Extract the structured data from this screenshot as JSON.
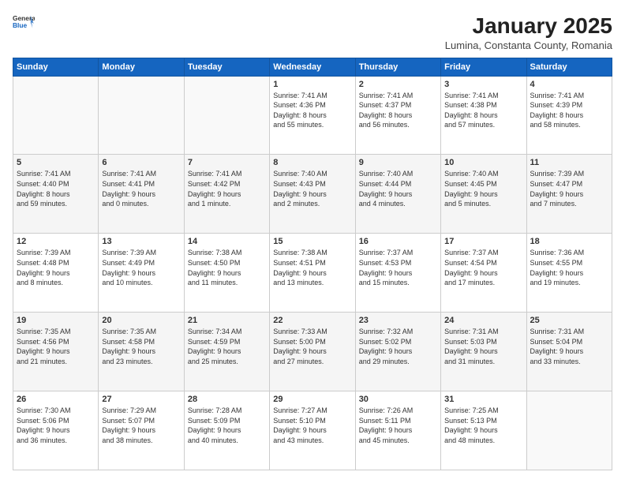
{
  "logo": {
    "general": "General",
    "blue": "Blue"
  },
  "header": {
    "title": "January 2025",
    "subtitle": "Lumina, Constanta County, Romania"
  },
  "weekdays": [
    "Sunday",
    "Monday",
    "Tuesday",
    "Wednesday",
    "Thursday",
    "Friday",
    "Saturday"
  ],
  "weeks": [
    [
      {
        "day": "",
        "info": ""
      },
      {
        "day": "",
        "info": ""
      },
      {
        "day": "",
        "info": ""
      },
      {
        "day": "1",
        "info": "Sunrise: 7:41 AM\nSunset: 4:36 PM\nDaylight: 8 hours\nand 55 minutes."
      },
      {
        "day": "2",
        "info": "Sunrise: 7:41 AM\nSunset: 4:37 PM\nDaylight: 8 hours\nand 56 minutes."
      },
      {
        "day": "3",
        "info": "Sunrise: 7:41 AM\nSunset: 4:38 PM\nDaylight: 8 hours\nand 57 minutes."
      },
      {
        "day": "4",
        "info": "Sunrise: 7:41 AM\nSunset: 4:39 PM\nDaylight: 8 hours\nand 58 minutes."
      }
    ],
    [
      {
        "day": "5",
        "info": "Sunrise: 7:41 AM\nSunset: 4:40 PM\nDaylight: 8 hours\nand 59 minutes."
      },
      {
        "day": "6",
        "info": "Sunrise: 7:41 AM\nSunset: 4:41 PM\nDaylight: 9 hours\nand 0 minutes."
      },
      {
        "day": "7",
        "info": "Sunrise: 7:41 AM\nSunset: 4:42 PM\nDaylight: 9 hours\nand 1 minute."
      },
      {
        "day": "8",
        "info": "Sunrise: 7:40 AM\nSunset: 4:43 PM\nDaylight: 9 hours\nand 2 minutes."
      },
      {
        "day": "9",
        "info": "Sunrise: 7:40 AM\nSunset: 4:44 PM\nDaylight: 9 hours\nand 4 minutes."
      },
      {
        "day": "10",
        "info": "Sunrise: 7:40 AM\nSunset: 4:45 PM\nDaylight: 9 hours\nand 5 minutes."
      },
      {
        "day": "11",
        "info": "Sunrise: 7:39 AM\nSunset: 4:47 PM\nDaylight: 9 hours\nand 7 minutes."
      }
    ],
    [
      {
        "day": "12",
        "info": "Sunrise: 7:39 AM\nSunset: 4:48 PM\nDaylight: 9 hours\nand 8 minutes."
      },
      {
        "day": "13",
        "info": "Sunrise: 7:39 AM\nSunset: 4:49 PM\nDaylight: 9 hours\nand 10 minutes."
      },
      {
        "day": "14",
        "info": "Sunrise: 7:38 AM\nSunset: 4:50 PM\nDaylight: 9 hours\nand 11 minutes."
      },
      {
        "day": "15",
        "info": "Sunrise: 7:38 AM\nSunset: 4:51 PM\nDaylight: 9 hours\nand 13 minutes."
      },
      {
        "day": "16",
        "info": "Sunrise: 7:37 AM\nSunset: 4:53 PM\nDaylight: 9 hours\nand 15 minutes."
      },
      {
        "day": "17",
        "info": "Sunrise: 7:37 AM\nSunset: 4:54 PM\nDaylight: 9 hours\nand 17 minutes."
      },
      {
        "day": "18",
        "info": "Sunrise: 7:36 AM\nSunset: 4:55 PM\nDaylight: 9 hours\nand 19 minutes."
      }
    ],
    [
      {
        "day": "19",
        "info": "Sunrise: 7:35 AM\nSunset: 4:56 PM\nDaylight: 9 hours\nand 21 minutes."
      },
      {
        "day": "20",
        "info": "Sunrise: 7:35 AM\nSunset: 4:58 PM\nDaylight: 9 hours\nand 23 minutes."
      },
      {
        "day": "21",
        "info": "Sunrise: 7:34 AM\nSunset: 4:59 PM\nDaylight: 9 hours\nand 25 minutes."
      },
      {
        "day": "22",
        "info": "Sunrise: 7:33 AM\nSunset: 5:00 PM\nDaylight: 9 hours\nand 27 minutes."
      },
      {
        "day": "23",
        "info": "Sunrise: 7:32 AM\nSunset: 5:02 PM\nDaylight: 9 hours\nand 29 minutes."
      },
      {
        "day": "24",
        "info": "Sunrise: 7:31 AM\nSunset: 5:03 PM\nDaylight: 9 hours\nand 31 minutes."
      },
      {
        "day": "25",
        "info": "Sunrise: 7:31 AM\nSunset: 5:04 PM\nDaylight: 9 hours\nand 33 minutes."
      }
    ],
    [
      {
        "day": "26",
        "info": "Sunrise: 7:30 AM\nSunset: 5:06 PM\nDaylight: 9 hours\nand 36 minutes."
      },
      {
        "day": "27",
        "info": "Sunrise: 7:29 AM\nSunset: 5:07 PM\nDaylight: 9 hours\nand 38 minutes."
      },
      {
        "day": "28",
        "info": "Sunrise: 7:28 AM\nSunset: 5:09 PM\nDaylight: 9 hours\nand 40 minutes."
      },
      {
        "day": "29",
        "info": "Sunrise: 7:27 AM\nSunset: 5:10 PM\nDaylight: 9 hours\nand 43 minutes."
      },
      {
        "day": "30",
        "info": "Sunrise: 7:26 AM\nSunset: 5:11 PM\nDaylight: 9 hours\nand 45 minutes."
      },
      {
        "day": "31",
        "info": "Sunrise: 7:25 AM\nSunset: 5:13 PM\nDaylight: 9 hours\nand 48 minutes."
      },
      {
        "day": "",
        "info": ""
      }
    ]
  ]
}
